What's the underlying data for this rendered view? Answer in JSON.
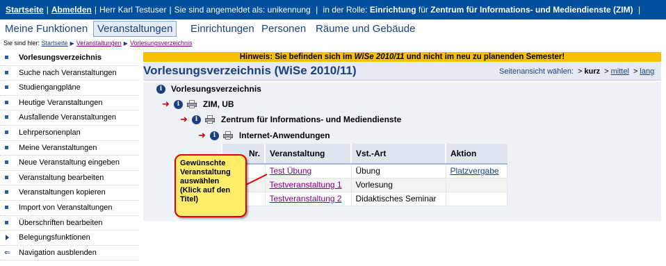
{
  "topbar": {
    "startseite": "Startseite",
    "abmelden": "Abmelden",
    "user": "Herr Karl Testuser",
    "logged_as_label": "Sie sind angemeldet als:",
    "login": "unikennung",
    "role_prefix": "in der Rolle:",
    "role": "Einrichtung",
    "role_for": "für",
    "institution": "Zentrum für Informations- und Mediendienste (ZIM)"
  },
  "mainnav": {
    "items": [
      "Meine Funktionen",
      "Veranstaltungen",
      "Einrichtungen",
      "Personen",
      "Räume und Gebäude"
    ],
    "active_index": 1
  },
  "breadcrumb": {
    "prefix": "Sie sind hier:",
    "items": [
      "Startseite",
      "Veranstaltungen",
      "Vorlesungsverzeichnis"
    ]
  },
  "sidebar": {
    "items": [
      {
        "label": "Vorlesungsverzeichnis",
        "icon": "bullet",
        "bold": true
      },
      {
        "label": "Suche nach Veranstaltungen",
        "icon": "bullet"
      },
      {
        "label": "Studiengangpläne",
        "icon": "bullet"
      },
      {
        "label": "Heutige Veranstaltungen",
        "icon": "bullet"
      },
      {
        "label": "Ausfallende Veranstaltungen",
        "icon": "bullet"
      },
      {
        "label": "Lehrpersonenplan",
        "icon": "bullet"
      },
      {
        "label": "Meine Veranstaltungen",
        "icon": "bullet"
      },
      {
        "label": "Neue Veranstaltung eingeben",
        "icon": "bullet"
      },
      {
        "label": "Veranstaltung bearbeiten",
        "icon": "bullet"
      },
      {
        "label": "Veranstaltungen kopieren",
        "icon": "bullet"
      },
      {
        "label": "Import von Veranstaltungen",
        "icon": "bullet"
      },
      {
        "label": "Überschriften bearbeiten",
        "icon": "bullet"
      },
      {
        "label": "Belegungsfunktionen",
        "icon": "triangle-right"
      },
      {
        "label": "Navigation ausblenden",
        "icon": "arrow-left"
      }
    ]
  },
  "warning": {
    "before": "Hinweis: Sie befinden sich im ",
    "term": "WiSe 2010/11",
    "after": " und nicht im neu zu planenden Semester!"
  },
  "page": {
    "title": "Vorlesungsverzeichnis (WiSe 2010/11)",
    "view_label": "Seitenansicht wählen:",
    "view_options": [
      "kurz",
      "mittel",
      "lang"
    ]
  },
  "tree": {
    "root": "Vorlesungsverzeichnis",
    "level1": "ZIM, UB",
    "level2": "Zentrum für Informations- und Mediendienste",
    "level3": "Internet-Anwendungen"
  },
  "table": {
    "headers": [
      "Nr.",
      "Veranstaltung",
      "Vst.-Art",
      "Aktion"
    ],
    "rows": [
      {
        "nr": "",
        "title": "Test Übung",
        "type": "Übung",
        "action": "Platzvergabe"
      },
      {
        "nr": "",
        "title": "Testveranstaltung 1",
        "type": "Vorlesung",
        "action": ""
      },
      {
        "nr": "",
        "title": "Testveranstaltung 2",
        "type": "Didaktisches Seminar",
        "action": ""
      }
    ]
  },
  "callout": {
    "text": "Gewünschte Veranstaltung auswählen (Klick auf den Titel)"
  },
  "colors": {
    "topbar": "#00509e",
    "accent": "#1c3f80",
    "warning": "#f5c000",
    "callout_fill": "#ffec6a",
    "callout_border": "#e00000",
    "visited_link": "#800080"
  }
}
